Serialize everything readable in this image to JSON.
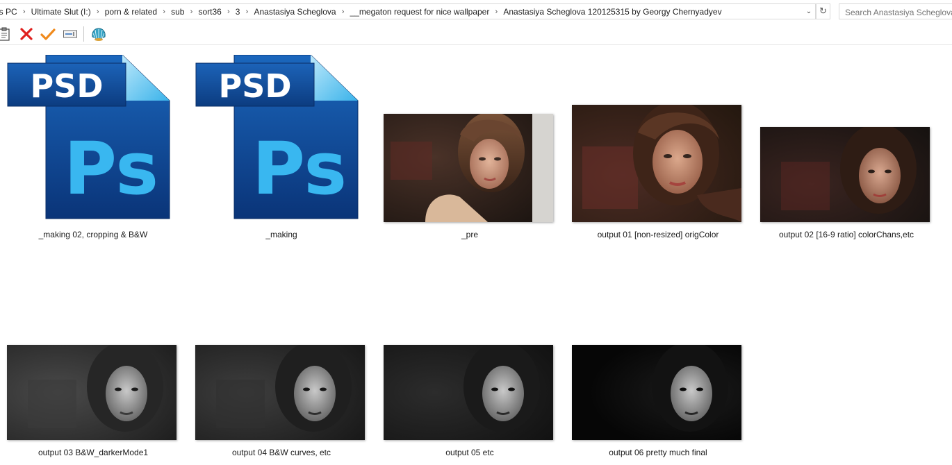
{
  "address_bar": {
    "crumbs": [
      "is PC",
      "Ultimate Slut (I:)",
      "porn & related",
      "sub",
      "sort36",
      "3",
      "Anastasiya Scheglova",
      "__megaton request for nice wallpaper",
      "Anastasiya Scheglova 120125315 by Georgy Chernyadyev"
    ],
    "separator": "›",
    "dropdown_glyph": "⌄",
    "refresh_glyph": "↻"
  },
  "search": {
    "placeholder": "Search Anastasiya Scheglova"
  },
  "toolbar": {
    "icons": [
      "properties-icon",
      "delete-icon",
      "checkmark-icon",
      "rename-icon",
      "shell-icon"
    ]
  },
  "psd_icon": {
    "badge_text": "PSD",
    "logo_text": "Ps"
  },
  "files": [
    {
      "name": "_making 02, cropping & B&W",
      "type": "psd"
    },
    {
      "name": "_making",
      "type": "psd"
    },
    {
      "name": "_pre",
      "type": "photo-color-pre"
    },
    {
      "name": "output 01 [non-resized] origColor",
      "type": "photo-color"
    },
    {
      "name": "output 02 [16-9 ratio] colorChans,etc",
      "type": "photo-color-dark"
    },
    {
      "name": "output 03 B&W_darkerMode1",
      "type": "photo-bw-1"
    },
    {
      "name": "output 04 B&W curves, etc",
      "type": "photo-bw-2"
    },
    {
      "name": "output 05 etc",
      "type": "photo-bw-3"
    },
    {
      "name": "output 06 pretty much final",
      "type": "photo-bw-4"
    }
  ],
  "colors": {
    "psd_dark_blue": "#0d3f86",
    "psd_light_blue": "#2ea8e8",
    "delete_red": "#e0201e",
    "check_orange": "#f08a1c"
  }
}
